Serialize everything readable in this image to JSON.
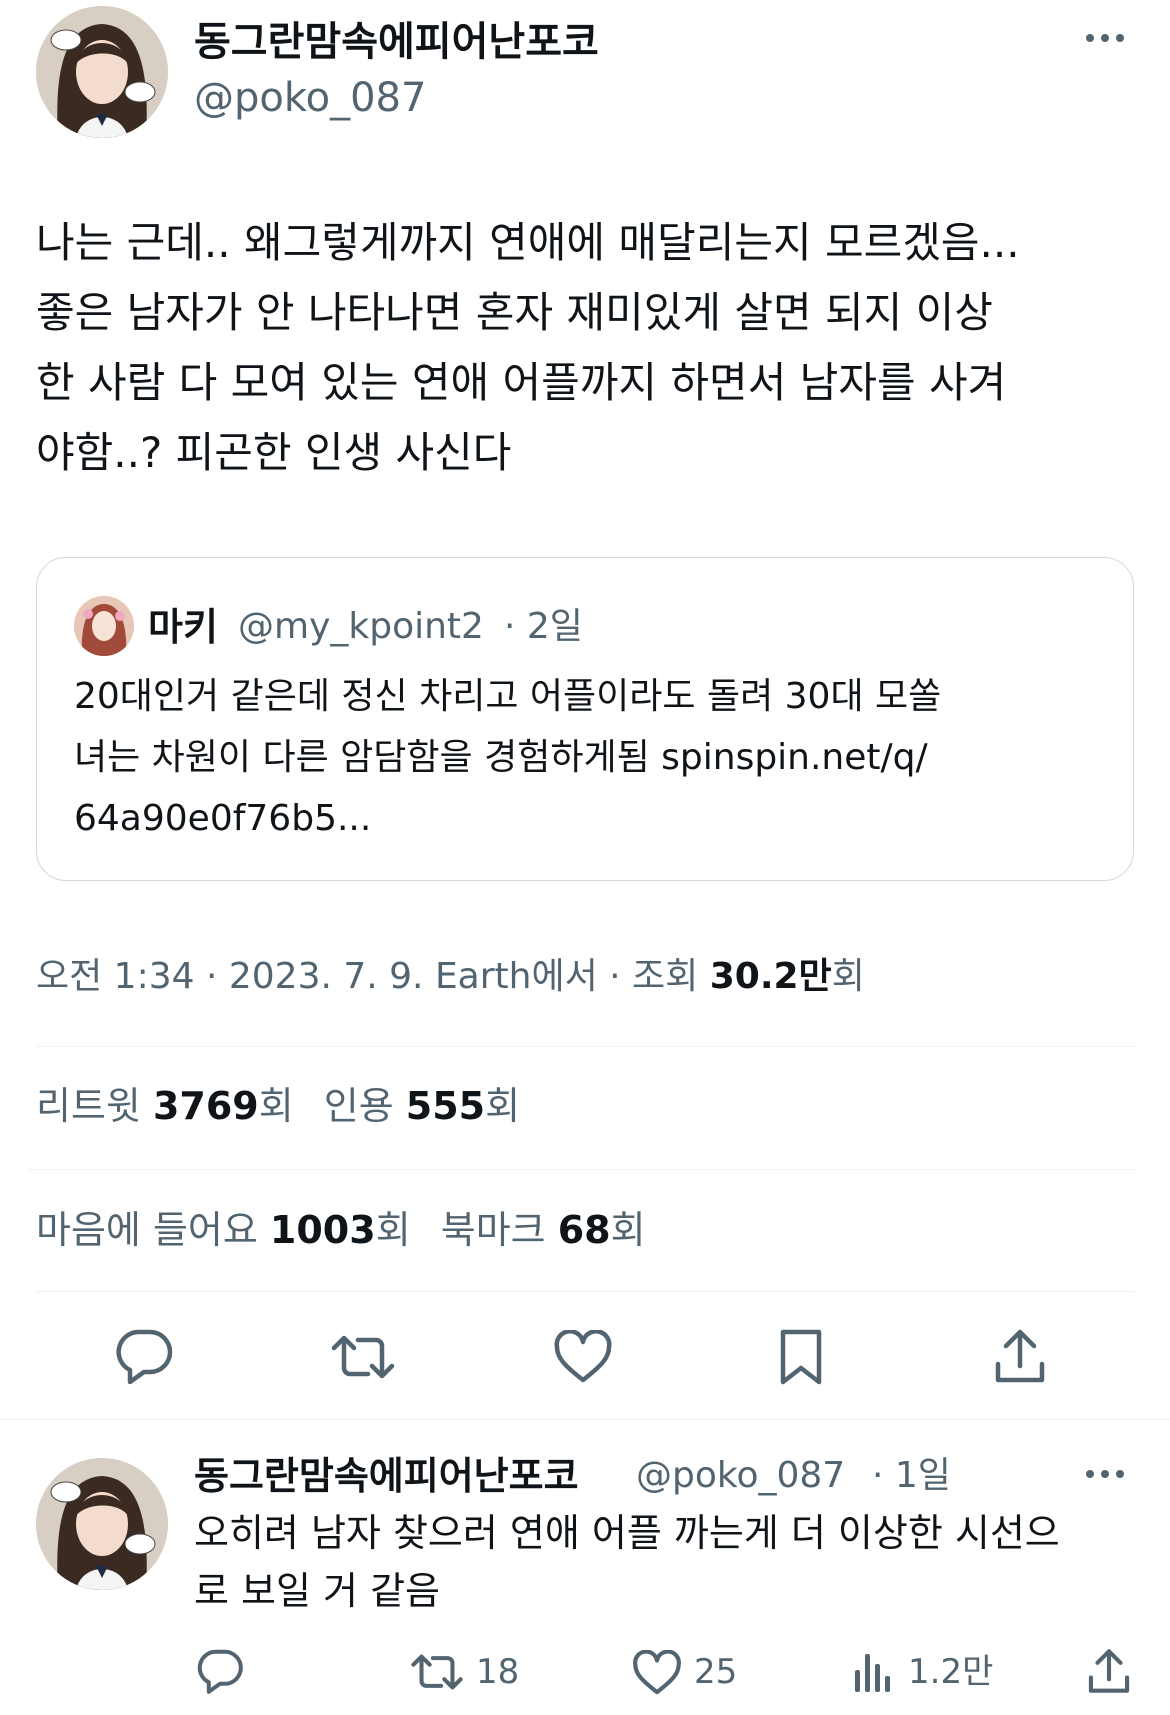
{
  "tweet": {
    "display_name": "동그란맘속에피어난포코",
    "handle": "@poko_087",
    "body_lines": [
      "나는 근데.. 왜그렇게까지 연애에 매달리는지 모르겠음...",
      "좋은 남자가 안 나타나면 혼자 재미있게 살면 되지 이상",
      "한 사람 다 모여 있는 연애 어플까지 하면서 남자를 사겨",
      "야함..? 피곤한 인생 사신다"
    ],
    "quote": {
      "display_name": "마키",
      "handle": "@my_kpoint2",
      "time": "· 2일",
      "lines": [
        "20대인거 같은데 정신 차리고 어플이라도 돌려 30대 모쏠",
        "녀는 차원이 다른 암담함을 경험하게됨 spinspin.net/q/",
        "64a90e0f76b5..."
      ]
    },
    "meta_prefix": "오전 1:34 · 2023. 7. 9. Earth에서 · 조회 ",
    "views_value": "30.2만",
    "views_suffix": "회",
    "stats_row1": {
      "retweets_label": "리트윗 ",
      "retweets_value": "3769",
      "retweets_suffix": "회",
      "quotes_label": "인용 ",
      "quotes_value": "555",
      "quotes_suffix": "회"
    },
    "stats_row2": {
      "likes_label": "마음에 들어요 ",
      "likes_value": "1003",
      "likes_suffix": "회",
      "bookmarks_label": "북마크 ",
      "bookmarks_value": "68",
      "bookmarks_suffix": "회"
    },
    "actions": [
      "reply-icon",
      "retweet-icon",
      "like-icon",
      "bookmark-icon",
      "share-icon"
    ]
  },
  "reply": {
    "display_name": "동그란맘속에피어난포코",
    "handle": "@poko_087",
    "time": "· 1일",
    "lines": [
      "오히려 남자 찾으러 연애 어플 까는게 더 이상한 시선으",
      "로 보일 거 같음"
    ],
    "retweet_count": "18",
    "like_count": "25",
    "view_count": "1.2만"
  },
  "colors": {
    "text_primary": "#0f1419",
    "text_secondary": "#536471",
    "divider": "#eff3f4",
    "card_border": "#cfd9de"
  }
}
